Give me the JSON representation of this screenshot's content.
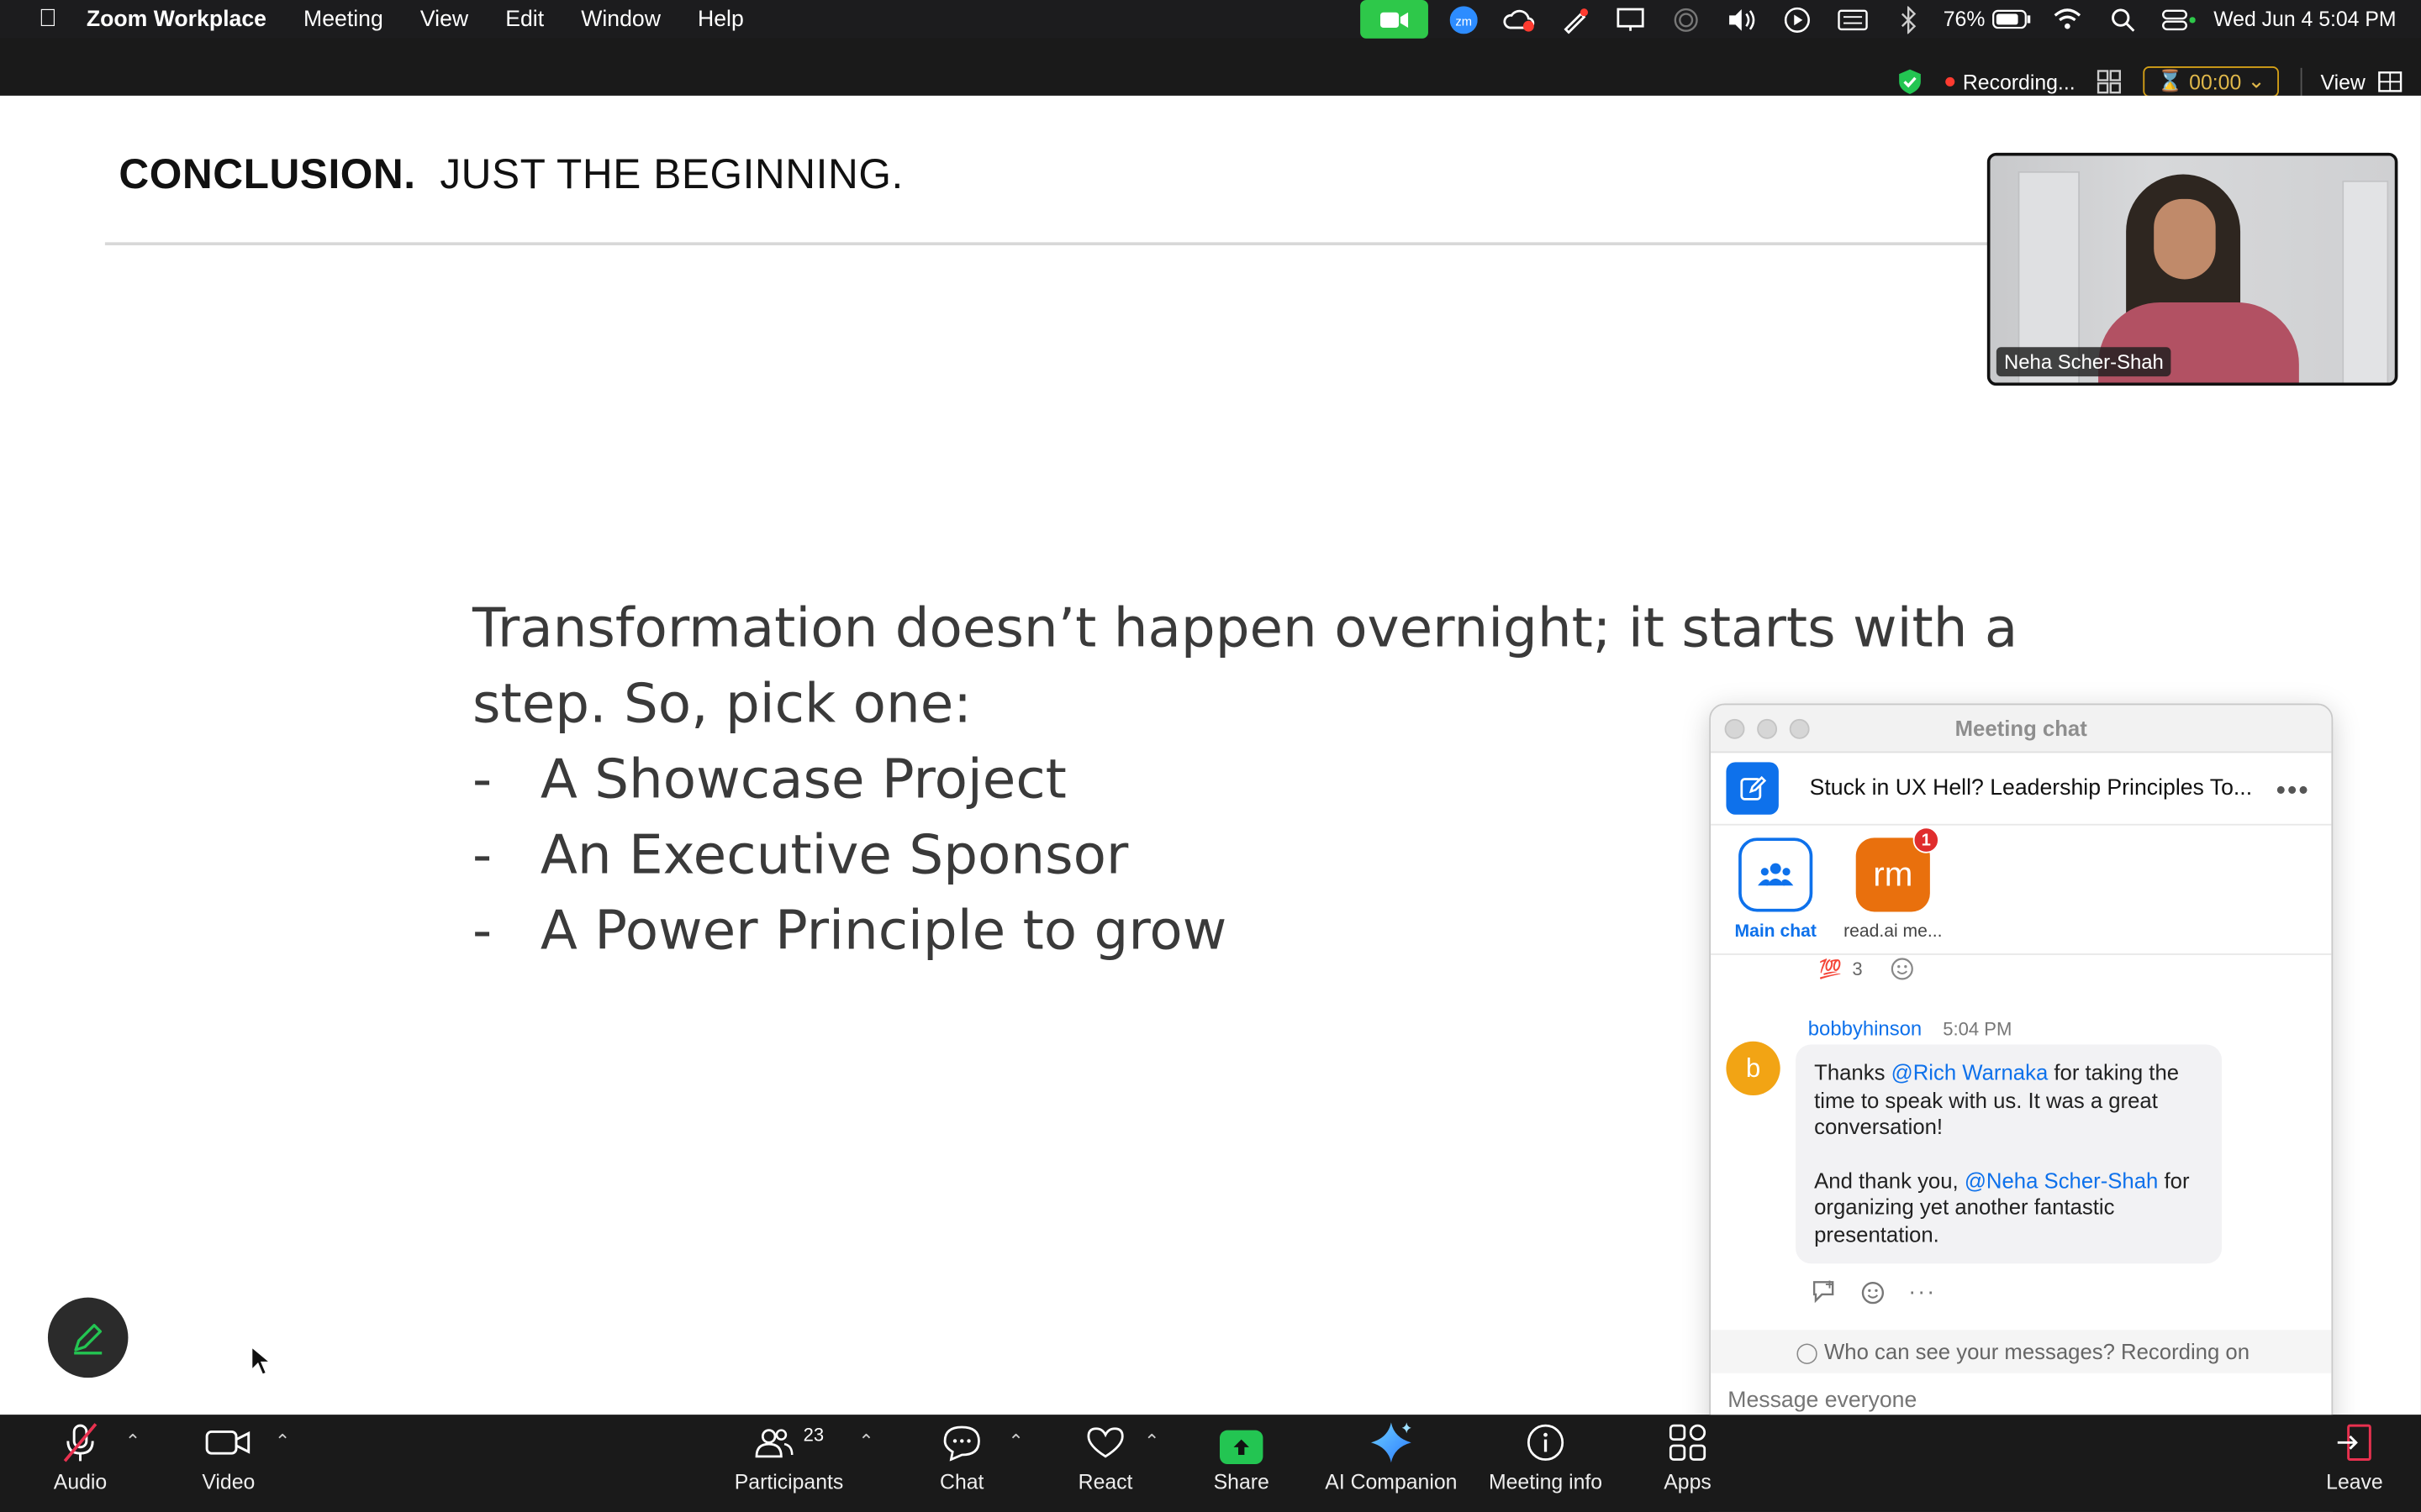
{
  "menubar": {
    "app_name": "Zoom Workplace",
    "items": [
      "Meeting",
      "View",
      "Edit",
      "Window",
      "Help"
    ],
    "battery": "76%",
    "datetime": "Wed Jun 4  5:04 PM"
  },
  "meeting_bar": {
    "recording_label": "Recording...",
    "timer": "00:00",
    "view_label": "View"
  },
  "slide": {
    "title_bold": "CONCLUSION.",
    "title_rest": "JUST THE BEGINNING.",
    "line1": "Transformation doesn’t happen overnight; it starts with a",
    "line2": "step.  So, pick one:",
    "bullets": [
      "A Showcase Project",
      "An Executive Sponsor",
      "A Power Principle to grow"
    ],
    "dash": "-"
  },
  "video": {
    "participant_name": "Neha Scher-Shah"
  },
  "chat": {
    "window_title": "Meeting chat",
    "meeting_name": "Stuck in UX Hell? Leadership Principles To...",
    "tabs": {
      "main_label": "Main chat",
      "readai_initials": "rm",
      "readai_label": "read.ai me...",
      "readai_badge": "1"
    },
    "reaction": {
      "emoji": "💯",
      "count": "3"
    },
    "message": {
      "avatar_initial": "b",
      "sender": "bobbyhinson",
      "time": "5:04 PM",
      "p1_a": "Thanks ",
      "p1_mention": "@Rich Warnaka",
      "p1_b": " for taking the time to speak with us. It was a great conversation!",
      "p2_a": "And thank you, ",
      "p2_mention": "@Neha Scher-Shah",
      "p2_b": " for organizing yet another fantastic presentation."
    },
    "privacy_text": "Who can see your messages? Recording on",
    "input_placeholder": "Message everyone"
  },
  "toolbar": {
    "audio": "Audio",
    "video": "Video",
    "participants": "Participants",
    "participants_count": "23",
    "chat": "Chat",
    "react": "React",
    "share": "Share",
    "ai_companion": "AI Companion",
    "meeting_info": "Meeting info",
    "apps": "Apps",
    "leave": "Leave"
  },
  "colors": {
    "accent": "#0e71eb",
    "share_green": "#23c552",
    "readai_orange": "#e9700d",
    "avatar_yellow": "#f2a414"
  }
}
